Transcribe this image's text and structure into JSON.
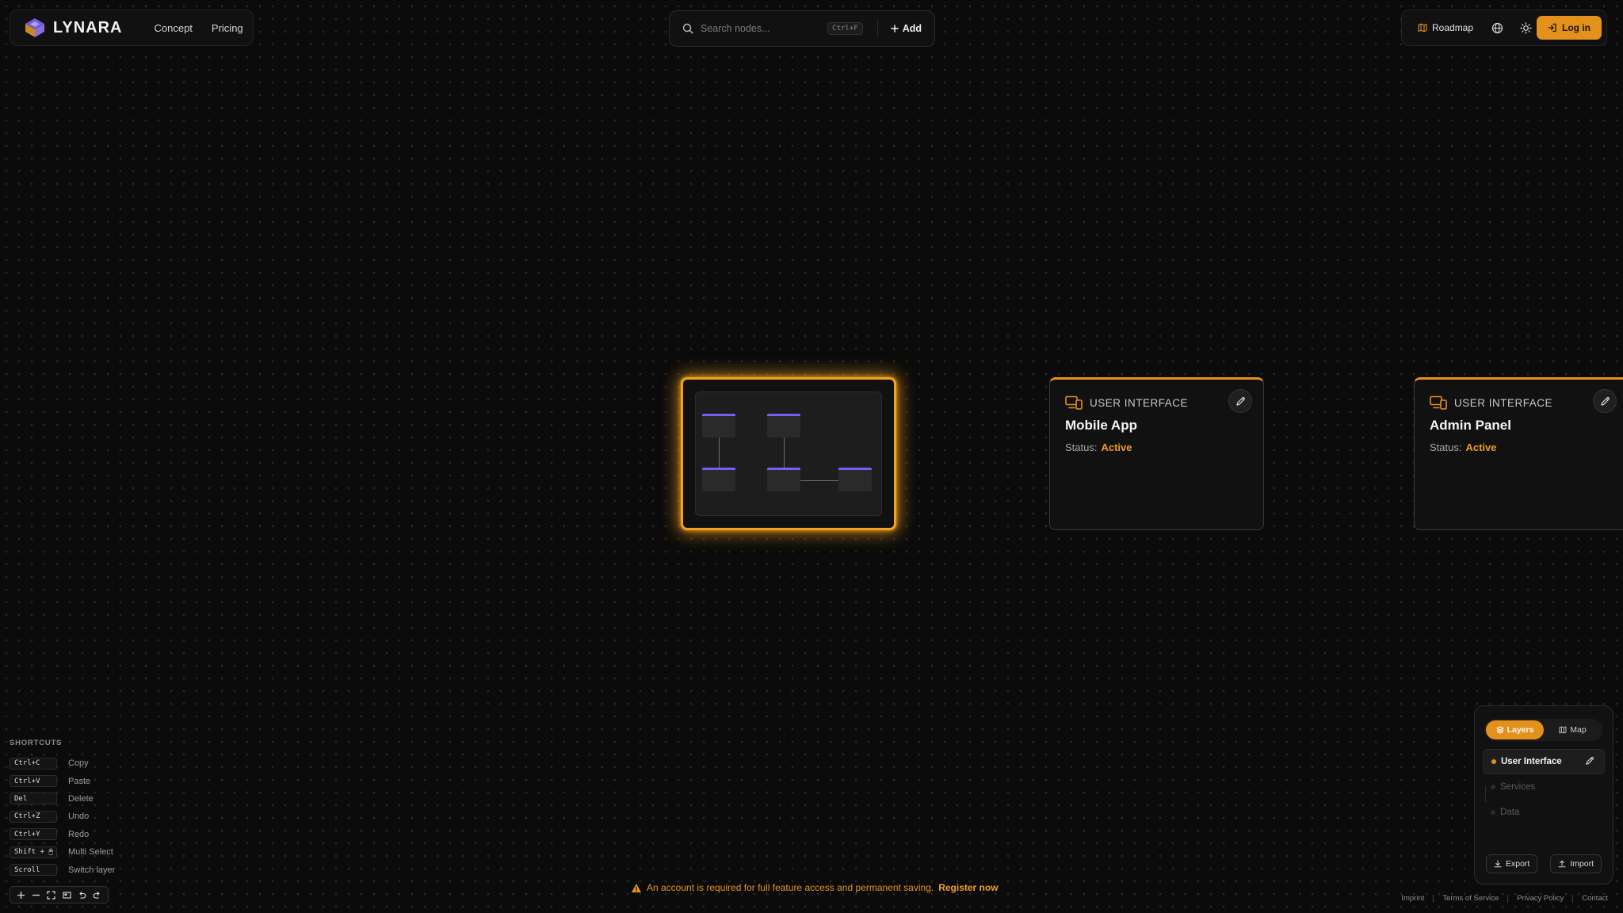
{
  "brand": {
    "name": "LYNARA"
  },
  "nav": {
    "concept": "Concept",
    "pricing": "Pricing"
  },
  "search": {
    "placeholder": "Search nodes...",
    "shortcut": "Ctrl+F",
    "add_label": "Add"
  },
  "toolbar": {
    "roadmap": "Roadmap",
    "login": "Log in"
  },
  "nodes": [
    {
      "type": "USER INTERFACE",
      "title": "Mobile App",
      "status_label": "Status:",
      "status": "Active"
    },
    {
      "type": "USER INTERFACE",
      "title": "Admin Panel",
      "status_label": "Status:",
      "status": "Active"
    }
  ],
  "shortcuts": {
    "title": "SHORTCUTS",
    "items": [
      {
        "key": "Ctrl+C",
        "label": "Copy"
      },
      {
        "key": "Ctrl+V",
        "label": "Paste"
      },
      {
        "key": "Del",
        "label": "Delete"
      },
      {
        "key": "Ctrl+Z",
        "label": "Undo"
      },
      {
        "key": "Ctrl+Y",
        "label": "Redo"
      },
      {
        "key": "Shift + 🖱",
        "label": "Multi Select"
      },
      {
        "key": "Scroll",
        "label": "Switch layer"
      }
    ]
  },
  "zoom_controls": [
    "plus-icon",
    "minus-icon",
    "fit-view-icon",
    "minimap-icon",
    "undo-icon",
    "redo-icon"
  ],
  "warning": {
    "text": "An account is required for full feature access and permanent saving.",
    "link": "Register now"
  },
  "layers_panel": {
    "tabs": [
      "Layers",
      "Map"
    ],
    "active_tab": "Layers",
    "layers": [
      "User Interface",
      "Services",
      "Data"
    ],
    "active_layer": "User Interface",
    "export": "Export",
    "import": "Import"
  },
  "footer": {
    "links": [
      "Imprint",
      "Terms of Service",
      "Privacy Policy",
      "Contact"
    ]
  },
  "colors": {
    "accent": "#e4911c",
    "preview_bar": "#7b5cf0",
    "background": "#0b0b0b"
  }
}
